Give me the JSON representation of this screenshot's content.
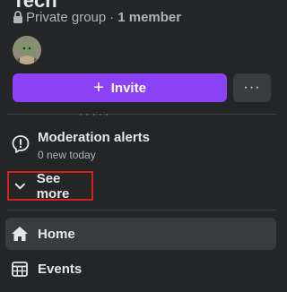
{
  "group": {
    "name": "Tech",
    "privacy_label": "Private group",
    "separator": "·",
    "member_count": "1 member"
  },
  "actions": {
    "invite_label": "Invite",
    "invite_icon": "+",
    "more_label": "···"
  },
  "clipped_text": "· · · · ·",
  "moderation": {
    "title": "Moderation alerts",
    "subtitle": "0 new today"
  },
  "see_more": {
    "label": "See more"
  },
  "nav": {
    "items": [
      {
        "label": "Home",
        "icon": "home-icon",
        "selected": true
      },
      {
        "label": "Events",
        "icon": "calendar-icon",
        "selected": false
      }
    ]
  },
  "colors": {
    "background": "#242526",
    "primary_button": "#8b42f5",
    "secondary_button": "#3a3b3c",
    "highlight_outline": "#d62020",
    "text_primary": "#e4e6eb",
    "text_secondary": "#b0b3b8"
  }
}
